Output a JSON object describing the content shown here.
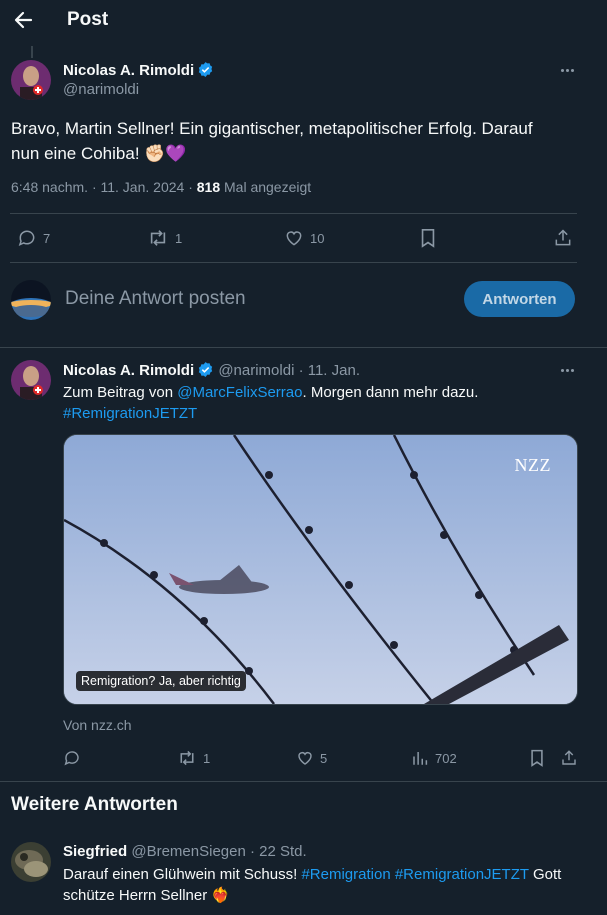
{
  "header": {
    "title": "Post"
  },
  "main_post": {
    "author_name": "Nicolas A. Rimoldi",
    "handle": "@narimoldi",
    "text": "Bravo, Martin Sellner! Ein gigantischer, metapolitischer Erfolg. Darauf nun eine Cohiba! ✊🏻💜",
    "timestamp": "6:48 nachm. · 11. Jan. 2024 ·",
    "views_count": "818",
    "views_label": "Mal angezeigt",
    "replies": "7",
    "reposts": "1",
    "likes": "10"
  },
  "composer": {
    "placeholder": "Deine Antwort posten",
    "button_label": "Antworten"
  },
  "reply_post": {
    "author_name": "Nicolas A. Rimoldi",
    "handle": "@narimoldi",
    "date": "· 11. Jan.",
    "text_prefix": "Zum Beitrag von ",
    "mention": "@MarcFelixSerrao",
    "text_suffix": ". Morgen dann mehr dazu.",
    "hashtag": "#RemigrationJETZT",
    "card_title": "Remigration? Ja, aber richtig",
    "card_watermark": "NZZ",
    "card_source": "Von nzz.ch",
    "replies": "",
    "reposts": "1",
    "likes": "5",
    "views": "702"
  },
  "more_replies": {
    "heading": "Weitere Antworten"
  },
  "third_post": {
    "author_name": "Siegfried",
    "handle": "@BremenSiegen",
    "date": "· 22 Std.",
    "text_prefix": "Darauf einen Glühwein mit Schuss! ",
    "hashtag1": "#Remigration",
    "hashtag2": "#RemigrationJETZT",
    "text_suffix": " Gott schütze Herrn Sellner ❤️‍🔥"
  },
  "colors": {
    "background": "#15202b",
    "text": "#f7f9f9",
    "muted": "#8b98a5",
    "link": "#1d9bf0",
    "divider": "#38444d",
    "button": "#1a6aa6"
  }
}
